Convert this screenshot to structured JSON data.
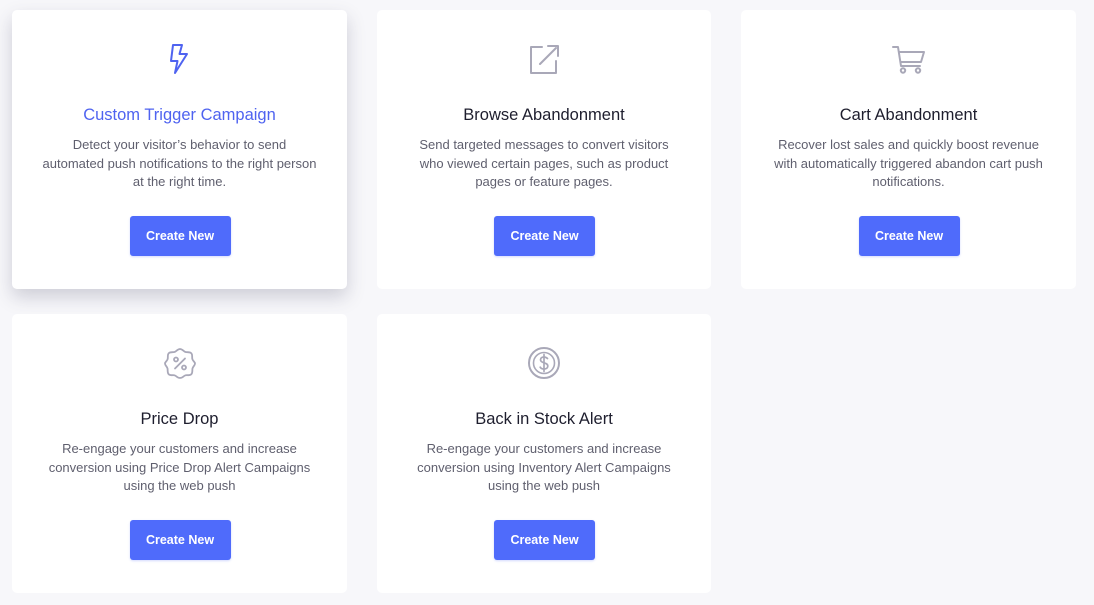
{
  "colors": {
    "accent": "#4f6bfb",
    "active_title": "#4f63f0",
    "icon_muted": "#a9a8b8",
    "background": "#f7f7fa"
  },
  "cards": [
    {
      "icon": "lightning-bolt-icon",
      "title": "Custom Trigger Campaign",
      "description": "Detect your visitor’s behavior to send automated push notifications to the right person at the right time.",
      "button_label": "Create New",
      "hovered": true
    },
    {
      "icon": "external-link-icon",
      "title": "Browse Abandonment",
      "description": "Send targeted messages to convert visitors who viewed certain pages, such as product pages or feature pages.",
      "button_label": "Create New"
    },
    {
      "icon": "shopping-cart-icon",
      "title": "Cart Abandonment",
      "description": "Recover lost sales and quickly boost revenue with automatically triggered abandon cart push notifications.",
      "button_label": "Create New"
    },
    {
      "icon": "discount-badge-icon",
      "title": "Price Drop",
      "description": "Re-engage your customers and increase conversion using Price Drop Alert Campaigns using the web push",
      "button_label": "Create New"
    },
    {
      "icon": "dollar-circle-icon",
      "title": "Back in Stock Alert",
      "description": "Re-engage your customers and increase conversion using Inventory Alert Campaigns using the web push",
      "button_label": "Create New"
    }
  ]
}
